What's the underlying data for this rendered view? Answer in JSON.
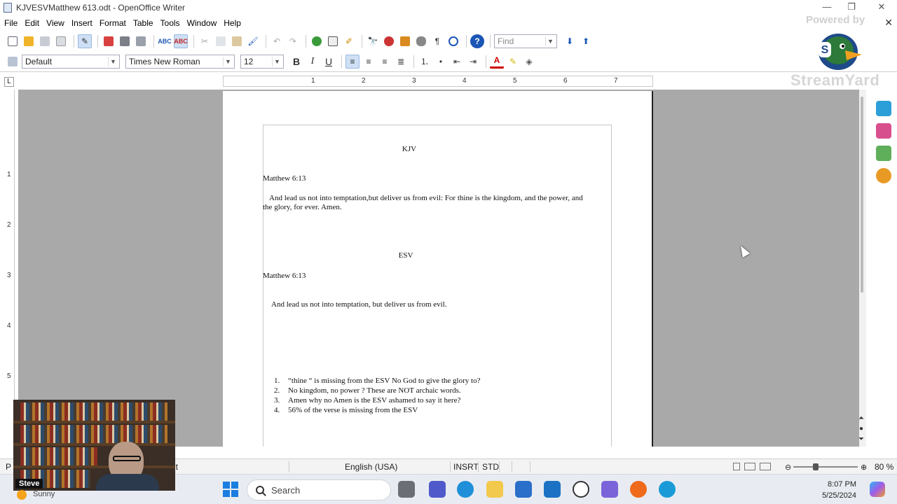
{
  "window": {
    "title": "KJVESVMatthew 613.odt - OpenOffice Writer",
    "minimize": "—",
    "restore": "❐",
    "close": "✕"
  },
  "menu": {
    "items": [
      "File",
      "Edit",
      "View",
      "Insert",
      "Format",
      "Table",
      "Tools",
      "Window",
      "Help"
    ],
    "close_doc": "✕"
  },
  "toolbar": {
    "find_placeholder": "Find",
    "paragraph_style": "Default",
    "font_name": "Times New Roman",
    "font_size": "12",
    "bold": "B",
    "italic": "I",
    "underline": "U"
  },
  "overlay": {
    "powered_by": "Powered by",
    "brand": "StreamYard"
  },
  "ruler": {
    "h_numbers": [
      "1",
      "2",
      "3",
      "4",
      "5",
      "6",
      "7"
    ],
    "v_numbers": [
      "1",
      "2",
      "3",
      "4",
      "5"
    ]
  },
  "document": {
    "kjv_heading": "KJV",
    "kjv_ref": "Matthew 6:13",
    "kjv_verse_line1": "And lead us not into temptation,but deliver us from evil: For thine is the kingdom, and the power, and",
    "kjv_verse_line2": "the glory, for ever. Amen.",
    "esv_heading": "ESV",
    "esv_ref": "Matthew 6:13",
    "esv_verse": "And lead us not into temptation, but deliver us from evil.",
    "points": [
      {
        "num": "1.",
        "text": "“thine “ is missing from the ESV No God to give the glory to?"
      },
      {
        "num": "2.",
        "text": "No kingdom, no power ? These are NOT archaic words."
      },
      {
        "num": "3.",
        "text": "Amen why no Amen is the ESV ashamed to say it here?"
      },
      {
        "num": "4.",
        "text": "56% of the verse is missing from the ESV"
      }
    ]
  },
  "statusbar": {
    "page_fragment": "P",
    "style_fragment": "lt",
    "language": "English (USA)",
    "insert_mode": "INSRT",
    "selection_mode": "STD",
    "zoom": "80 %"
  },
  "webcam": {
    "name": "Steve"
  },
  "weather": {
    "condition": "Sunny"
  },
  "taskbar": {
    "search_label": "Search",
    "time": "8:07 PM",
    "date": "5/25/2024"
  },
  "colors": {
    "workspace": "#a9a9a9",
    "accent": "#1a7de0"
  }
}
